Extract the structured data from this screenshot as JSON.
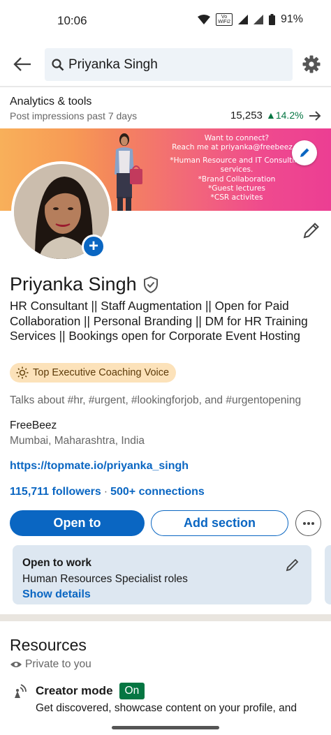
{
  "status_bar": {
    "time": "10:06",
    "volte_top": "Vo",
    "volte_bottom": "WiFi2",
    "battery": "91%"
  },
  "search": {
    "query": "Priyanka Singh"
  },
  "analytics": {
    "title": "Analytics & tools",
    "subtitle": "Post impressions past 7 days",
    "impressions": "15,253",
    "change": "14.2%"
  },
  "banner": {
    "lines": [
      "Want to connect?",
      "Reach me at priyanka@freebeez.in",
      "",
      "*Human Resource and IT Consulting",
      "services.",
      "*Brand Collaboration",
      "*Guest lectures",
      "*CSR activites"
    ]
  },
  "profile": {
    "name": "Priyanka Singh",
    "headline": "HR Consultant || Staff Augmentation || Open for Paid Collaboration || Personal Branding || DM for HR Training Services || Bookings open for Corporate Event Hosting",
    "badge": "Top Executive Coaching Voice",
    "talks_about": "Talks about #hr, #urgent, #lookingforjob, and #urgentopening",
    "company": "FreeBeez",
    "location": "Mumbai, Maharashtra, India",
    "link": "https://topmate.io/priyanka_singh",
    "followers": "115,711 followers",
    "separator": "·",
    "connections": "500+ connections"
  },
  "actions": {
    "open_to": "Open to",
    "add_section": "Add section"
  },
  "open_to_work": {
    "title": "Open to work",
    "roles": "Human Resources Specialist roles",
    "show_details": "Show details"
  },
  "resources": {
    "title": "Resources",
    "privacy": "Private to you",
    "creator_mode": "Creator mode",
    "creator_status": "On",
    "creator_desc": "Get discovered, showcase content on your profile, and"
  },
  "colors": {
    "brand_blue": "#0a66c2",
    "positive_green": "#057642",
    "card_bg": "#dde7f1",
    "badge_bg": "#fce2ba"
  }
}
